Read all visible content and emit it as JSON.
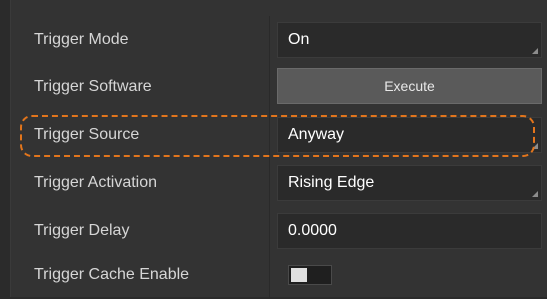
{
  "colors": {
    "panel_bg": "#333333",
    "field_bg": "#2a2a2a",
    "button_bg": "#5a5a5a",
    "label_text": "#d6d6d6",
    "value_text": "#ffffff",
    "highlight": "#e2751c"
  },
  "rows": {
    "trigger_mode": {
      "label": "Trigger Mode",
      "value": "On"
    },
    "trigger_software": {
      "label": "Trigger Software",
      "button_label": "Execute"
    },
    "trigger_source": {
      "label": "Trigger Source",
      "value": "Anyway"
    },
    "trigger_activation": {
      "label": "Trigger Activation",
      "value": "Rising Edge"
    },
    "trigger_delay": {
      "label": "Trigger Delay",
      "value": "0.0000"
    },
    "trigger_cache_enable": {
      "label": "Trigger Cache Enable",
      "enabled": false
    }
  }
}
